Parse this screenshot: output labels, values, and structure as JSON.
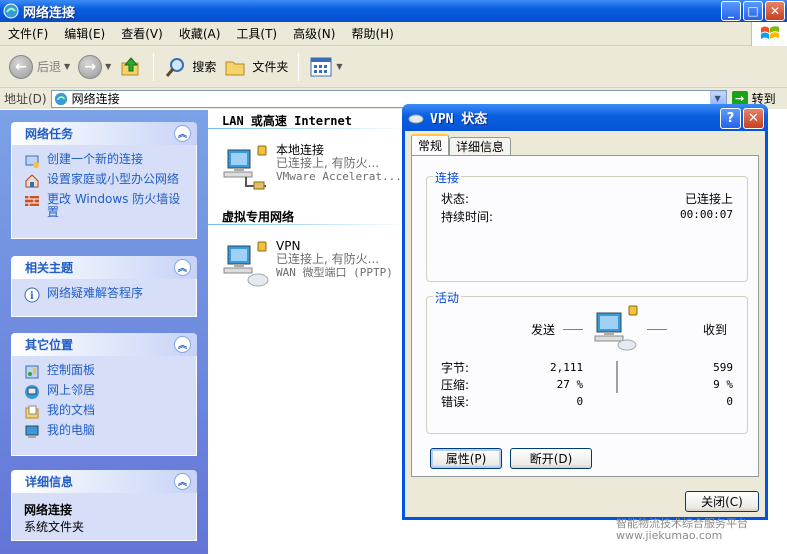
{
  "window": {
    "title": "网络连接"
  },
  "menu": [
    "文件(F)",
    "编辑(E)",
    "查看(V)",
    "收藏(A)",
    "工具(T)",
    "高级(N)",
    "帮助(H)"
  ],
  "toolbar": {
    "back": "后退",
    "search": "搜索",
    "folders": "文件夹"
  },
  "address": {
    "label": "地址(D)",
    "value": "网络连接",
    "go": "转到"
  },
  "tasks": {
    "network": {
      "title": "网络任务",
      "items": [
        "创建一个新的连接",
        "设置家庭或小型办公网络",
        "更改 Windows 防火墙设置"
      ]
    },
    "related": {
      "title": "相关主题",
      "items": [
        "网络疑难解答程序"
      ]
    },
    "other": {
      "title": "其它位置",
      "items": [
        "控制面板",
        "网上邻居",
        "我的文档",
        "我的电脑"
      ]
    },
    "details": {
      "title": "详细信息",
      "name": "网络连接",
      "sub": "系统文件夹"
    }
  },
  "groups": {
    "lan": {
      "header": "LAN 或高速 Internet",
      "name": "本地连接",
      "status": "已连接上, 有防火...",
      "device": "VMware Accelerat..."
    },
    "vpn": {
      "header": "虚拟专用网络",
      "name": "VPN",
      "status": "已连接上, 有防火...",
      "device": "WAN 微型端口 (PPTP)"
    }
  },
  "dialog": {
    "title": "VPN 状态",
    "tabs": [
      "常规",
      "详细信息"
    ],
    "connection": {
      "label": "连接",
      "status_label": "状态:",
      "status_value": "已连接上",
      "duration_label": "持续时间:",
      "duration_value": "00:00:07"
    },
    "activity": {
      "label": "活动",
      "sent": "发送",
      "received": "收到",
      "rows": [
        {
          "label": "字节:",
          "sent": "2,111",
          "recv": "599"
        },
        {
          "label": "压缩:",
          "sent": "27 %",
          "recv": "9 %"
        },
        {
          "label": "错误:",
          "sent": "0",
          "recv": "0"
        }
      ]
    },
    "buttons": {
      "properties": "属性(P)",
      "disconnect": "断开(D)",
      "close": "关闭(C)"
    }
  },
  "watermark": {
    "line1": "智能物流技术综合服务平台",
    "line2": "www.jiekumao.com"
  },
  "colors": {
    "xp_blue": "#0054e3",
    "taskpane": "#6375d6",
    "link": "#215dc6"
  }
}
